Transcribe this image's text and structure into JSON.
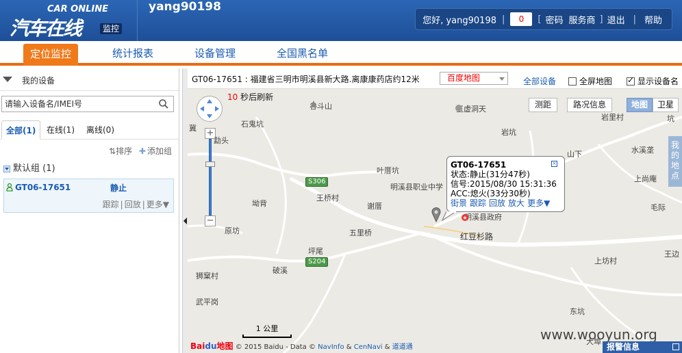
{
  "header": {
    "logo_en": "CAR ONLINE",
    "logo_cn": "汽车在线",
    "logo_tag": "监控",
    "username": "yang90198",
    "greeting": "您好, yang90198",
    "alert_count": "0",
    "links": {
      "password": "密码",
      "dealer": "服务商",
      "logout": "退出",
      "help": "帮助"
    }
  },
  "nav": {
    "items": [
      "定位监控",
      "统计报表",
      "设备管理",
      "全国黑名单"
    ],
    "active": 0
  },
  "sidebar": {
    "title": "我的设备",
    "search_placeholder": "请输入设备名/IMEI号",
    "tabs": [
      "全部(1)",
      "在线(1)",
      "离线(0)"
    ],
    "sort_label": "排序",
    "add_group_label": "添加组",
    "group_label": "默认组 (1)",
    "device": {
      "name": "GT06-17651",
      "status": "静止",
      "actions": [
        "跟踪",
        "回放",
        "更多▼"
      ]
    }
  },
  "mapbar": {
    "address": "GT06-17651 : 福建省三明市明溪县新大路.离康康药店约12米",
    "map_type": "百度地图",
    "all_devices": "全部设备",
    "fullscreen_label": "全屏地图",
    "fullscreen_checked": false,
    "show_name_label": "显示设备名",
    "show_name_checked": true
  },
  "map": {
    "refresh_seconds": "10",
    "refresh_text": "秒后刷新",
    "tools": [
      "测距",
      "路况信息"
    ],
    "map_types": [
      "地图",
      "卫星"
    ],
    "side_tab": "我的地点",
    "labels": [
      "谷斗山",
      "玉虚洞天",
      "石鬼坑",
      "岩坑",
      "岩里村",
      "山下",
      "水溪垄",
      "叶厝坑",
      "明溪县职业中学",
      "上尚庵",
      "王桥村",
      "坳背",
      "谢厝",
      "明溪县政府",
      "毛际",
      "五里桥",
      "红豆杉路",
      "原坊",
      "坪尾",
      "上坊村",
      "王边",
      "狮窠村",
      "破溪",
      "武平岗",
      "东坑",
      "大埠",
      "坑",
      "冀",
      "勐头"
    ],
    "road_signs": [
      "S306",
      "S204"
    ],
    "popup": {
      "title": "GT06-17651",
      "status": "状态:静止(31分47秒)",
      "signal": "信号:2015/08/30 15:31:36",
      "acc": "ACC:熄火(33分30秒)",
      "actions": [
        "街景",
        "跟踪",
        "回放",
        "放大",
        "更多▼"
      ]
    },
    "scale": "1 公里",
    "copyright_prefix": "© 2015 Baidu - Data ©",
    "providers": [
      "NavInfo",
      "CenNavi",
      "道道通"
    ],
    "watermark": "www.wooyun.org",
    "alarm_label": "报警信息"
  },
  "colors": {
    "header": "#2b66b5",
    "nav_active": "#f07a1a",
    "link": "#1a5bb2",
    "red": "#e00000"
  }
}
